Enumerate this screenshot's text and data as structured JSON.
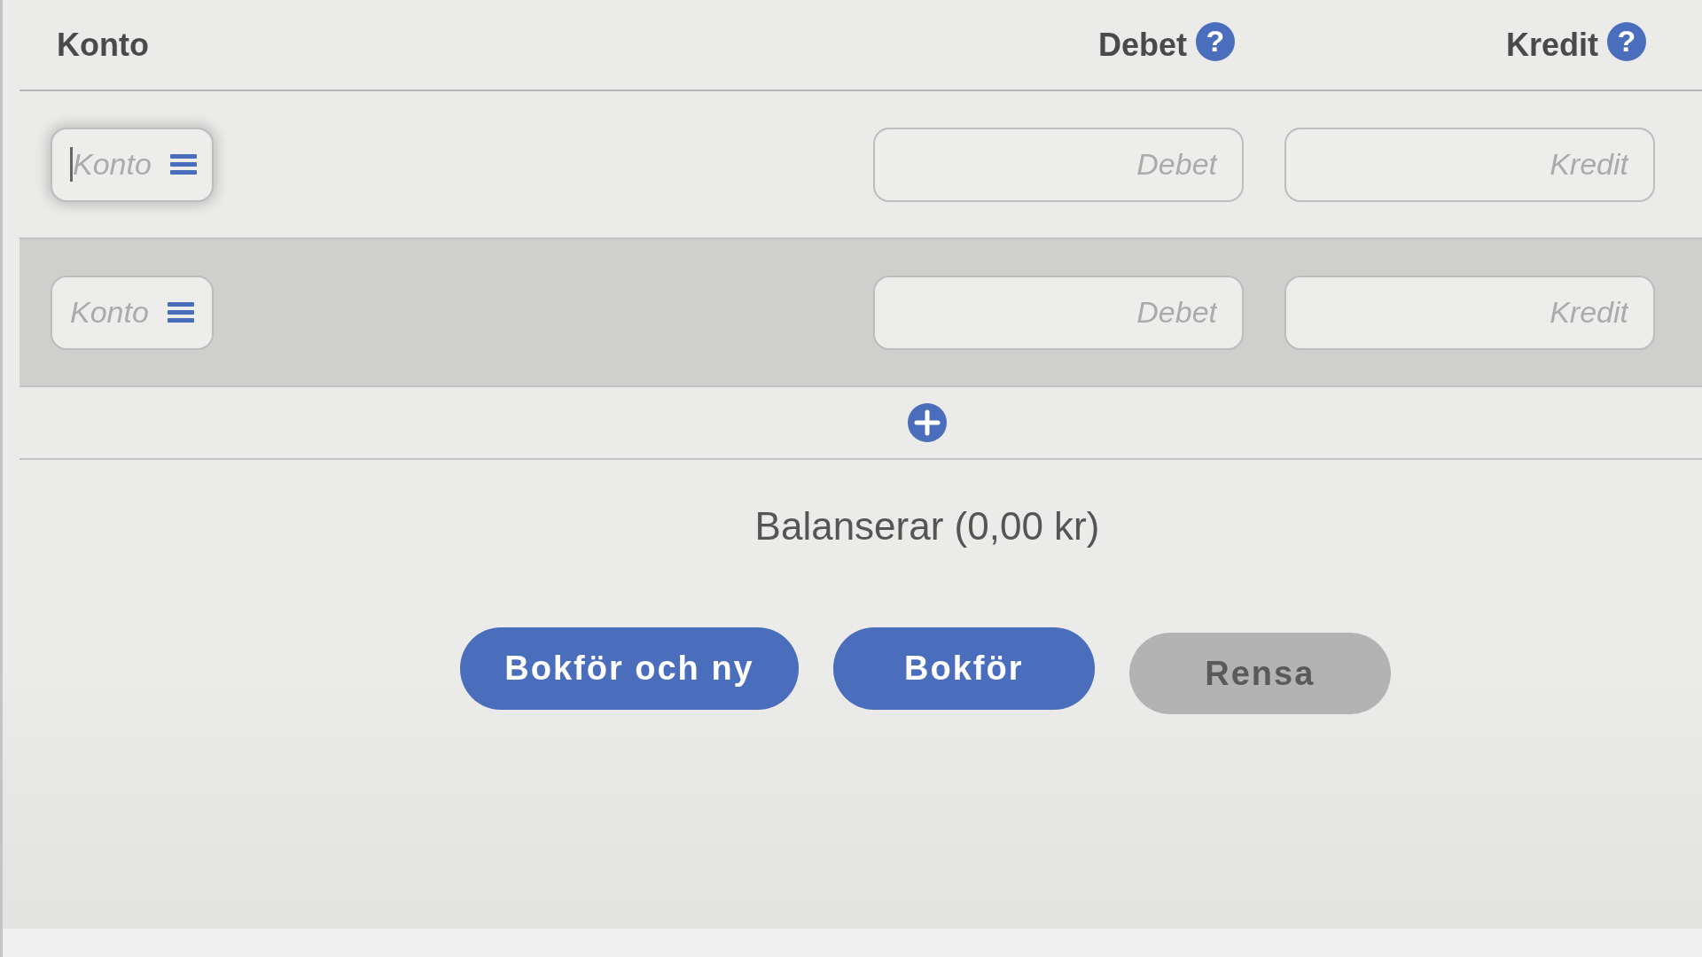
{
  "columns": [
    {
      "label": "Konto"
    },
    {
      "label": "Debet",
      "help": "?"
    },
    {
      "label": "Kredit",
      "help": "?"
    }
  ],
  "rows": [
    {
      "hovered": false,
      "konto": {
        "placeholder": "Konto",
        "focused": true
      },
      "debet": {
        "placeholder": "Debet"
      },
      "kredit": {
        "placeholder": "Kredit"
      }
    },
    {
      "hovered": true,
      "konto": {
        "placeholder": "Konto",
        "focused": false
      },
      "debet": {
        "placeholder": "Debet"
      },
      "kredit": {
        "placeholder": "Kredit"
      }
    }
  ],
  "balance": "Balanserar (0,00 kr)",
  "buttons": [
    {
      "label": "Bokför och ny",
      "kind": "primary"
    },
    {
      "label": "Bokför",
      "kind": "primary"
    },
    {
      "label": "Rensa",
      "kind": "secondary"
    }
  ]
}
